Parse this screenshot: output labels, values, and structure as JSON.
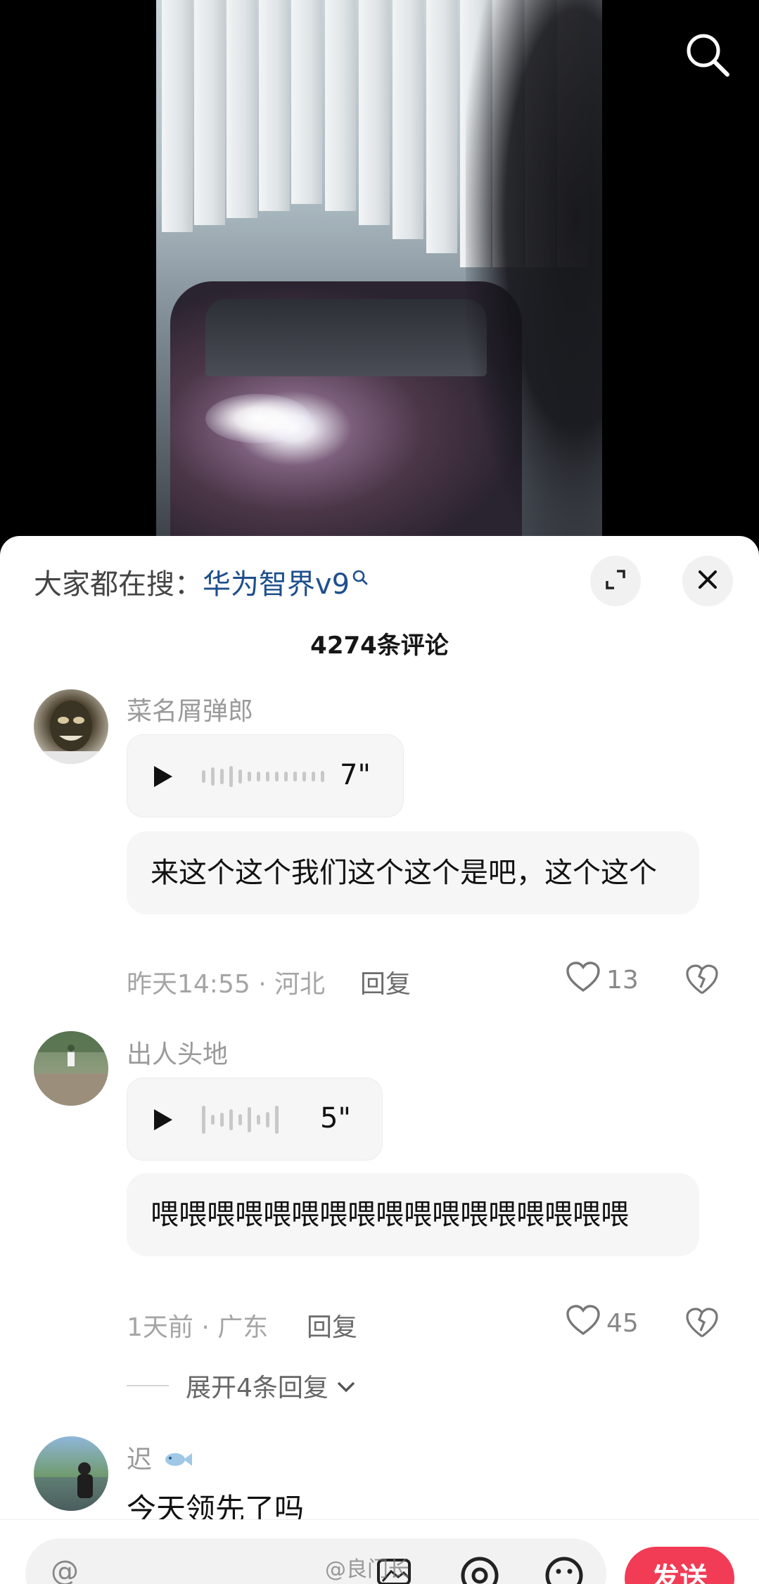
{
  "search_banner": {
    "prefix": "大家都在搜：",
    "term": "华为智界v9"
  },
  "comments_title": "4274条评论",
  "comments": [
    {
      "username": "菜名屑弹郎",
      "voice_duration": "7\"",
      "transcript": "来这个这个我们这个这个是吧，这个这个",
      "meta": "昨天14:55 · 河北",
      "reply_label": "回复",
      "likes": "13"
    },
    {
      "username": "出人头地",
      "voice_duration": "5\"",
      "transcript": "喂喂喂喂喂喂喂喂喂喂喂喂喂喂喂喂喂",
      "meta": "1天前 · 广东",
      "reply_label": "回复",
      "likes": "45",
      "expand_label": "展开4条回复"
    },
    {
      "username": "迟",
      "text": "今天领先了吗"
    }
  ],
  "input": {
    "placeholder": "@",
    "send_label": "发送"
  },
  "watermark": "@良门长",
  "colors": {
    "send_button": "#f23b55",
    "search_term": "#1f4f8c"
  },
  "icons": [
    "search-icon",
    "expand-icon",
    "close-icon",
    "play-icon",
    "heart-icon",
    "broken-heart-icon",
    "image-icon",
    "at-icon",
    "emoji-icon",
    "chevron-down-icon"
  ]
}
